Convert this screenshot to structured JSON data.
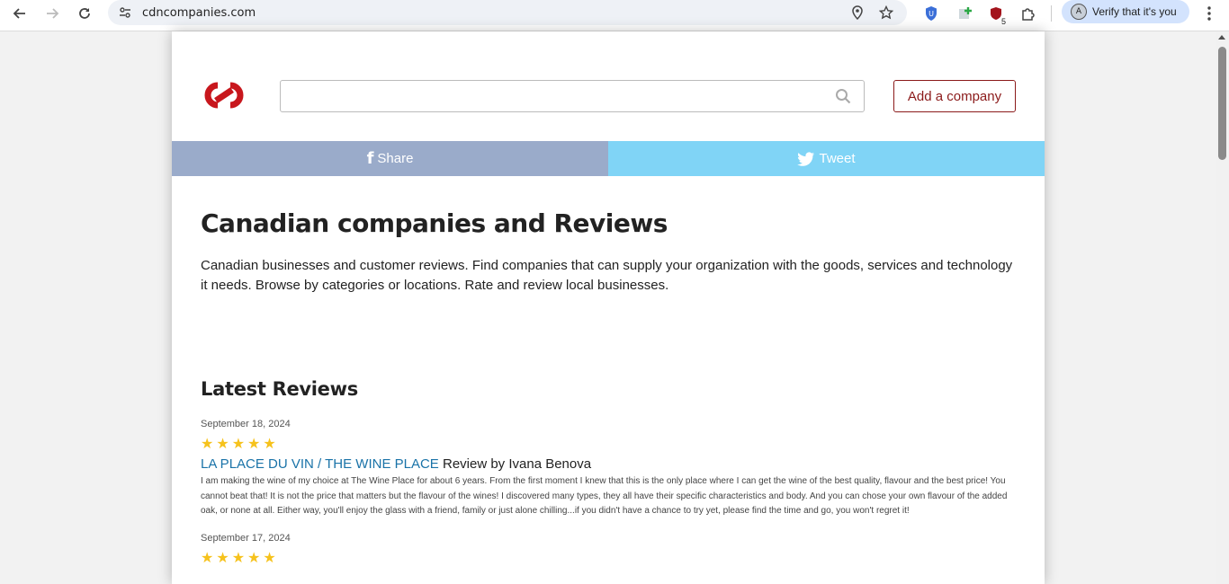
{
  "browser": {
    "url": "cdncompanies.com",
    "profile_initial": "A",
    "verify_label": "Verify that it's you",
    "extension_badge": "5"
  },
  "header": {
    "search_placeholder": "",
    "add_company_label": "Add a company"
  },
  "share": {
    "facebook_label": "Share",
    "twitter_label": "Tweet"
  },
  "main": {
    "title": "Canadian companies and Reviews",
    "intro": "Canadian businesses and customer reviews. Find companies that can supply your organization with the goods, services and technology it needs. Browse by categories or locations. Rate and review local businesses.",
    "latest_heading": "Latest Reviews"
  },
  "reviews": [
    {
      "date": "September 18, 2024",
      "stars": "★★★★★",
      "rating": 5,
      "company": "LA PLACE DU VIN / THE WINE PLACE",
      "byline": "Review by Ivana Benova",
      "text": "I am making the wine of my choice at The Wine Place for about 6 years. From the first moment I knew that this is the only place where I can get the wine of the best quality, flavour and the best price! You cannot beat that! It is not the price that matters but the flavour of the wines! I discovered many types, they all have their specific characteristics and body. And you can chose your own flavour of the added oak, or none at all. Either way, you'll enjoy the glass with a friend, family or just alone chilling...if you didn't have a chance to try yet, please find the time and go, you won't regret it!"
    },
    {
      "date": "September 17, 2024",
      "stars": "★★★★★",
      "rating": 5,
      "company": "",
      "byline": "",
      "text": ""
    }
  ],
  "colors": {
    "brand_red": "#c8171d",
    "add_company_border": "#8b1a1a",
    "facebook_bar": "#9aabca",
    "twitter_bar": "#80d4f6",
    "link_blue": "#1a73a8",
    "star_gold": "#f6c21c"
  }
}
